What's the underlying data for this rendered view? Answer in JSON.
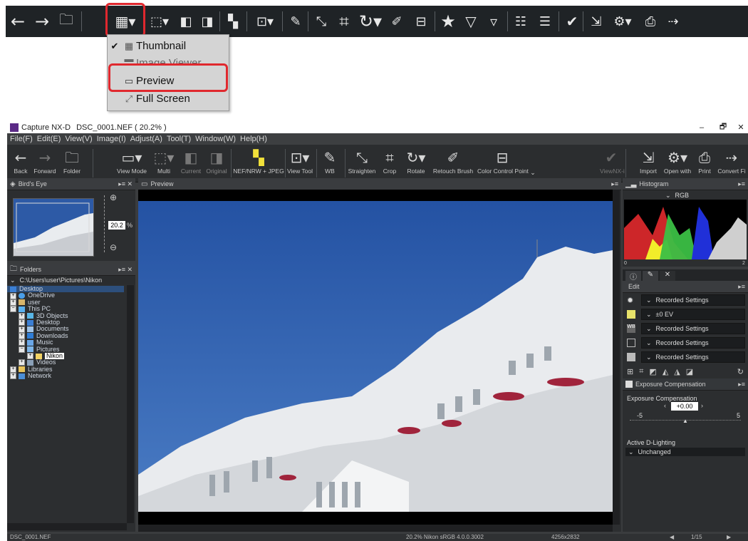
{
  "dropdown": {
    "items": [
      {
        "label": "Thumbnail",
        "checked": true,
        "icon": "grid-icon"
      },
      {
        "label": "Image Viewer",
        "checked": false,
        "icon": "filmstrip-icon"
      },
      {
        "label": "Preview",
        "checked": false,
        "icon": "preview-icon"
      },
      {
        "label": "Full Screen",
        "checked": false,
        "icon": "fullscreen-icon"
      }
    ]
  },
  "window": {
    "app_name": "Capture NX-D",
    "file_title": "DSC_0001.NEF ( 20.2% )",
    "controls": {
      "minimize": "–",
      "restore": "🗗",
      "close": "✕"
    }
  },
  "menubar": [
    "File(F)",
    "Edit(E)",
    "View(V)",
    "Image(I)",
    "Adjust(A)",
    "Tool(T)",
    "Window(W)",
    "Help(H)"
  ],
  "toolbar": {
    "back": "Back",
    "forward": "Forward",
    "folder": "Folder",
    "view_mode": "View Mode",
    "multi": "Multi",
    "current": "Current",
    "original": "Original",
    "nef_jpeg": "NEF/NRW + JPEG",
    "view_tool": "View Tool",
    "wb": "WB",
    "straighten": "Straighten",
    "crop": "Crop",
    "rotate": "Rotate",
    "retouch": "Retouch Brush",
    "color_control": "Color Control Point",
    "viewnx": "ViewNX-i",
    "import": "Import",
    "open_with": "Open with",
    "print": "Print",
    "convert": "Convert Fi"
  },
  "birds_eye": {
    "title": "Bird's Eye",
    "zoom_value": "20.2",
    "zoom_unit": "%"
  },
  "folders": {
    "title": "Folders",
    "path": "C:\\Users\\user\\Pictures\\Nikon",
    "tree": [
      {
        "label": "Desktop",
        "level": 0,
        "selected_row": true
      },
      {
        "label": "OneDrive",
        "level": 1
      },
      {
        "label": "user",
        "level": 1
      },
      {
        "label": "This PC",
        "level": 1
      },
      {
        "label": "3D Objects",
        "level": 2
      },
      {
        "label": "Desktop",
        "level": 2
      },
      {
        "label": "Documents",
        "level": 2
      },
      {
        "label": "Downloads",
        "level": 2
      },
      {
        "label": "Music",
        "level": 2
      },
      {
        "label": "Pictures",
        "level": 2
      },
      {
        "label": "Nikon",
        "level": 3,
        "highlight": true
      },
      {
        "label": "Videos",
        "level": 2
      },
      {
        "label": "Libraries",
        "level": 1
      },
      {
        "label": "Network",
        "level": 1
      }
    ]
  },
  "preview": {
    "title": "Preview"
  },
  "histogram": {
    "title": "Histogram",
    "channel": "RGB",
    "axis_min": "0",
    "axis_max": "2"
  },
  "edit": {
    "title": "Edit",
    "rows": [
      {
        "value": "Recorded Settings",
        "icon": "camera-settings-icon"
      },
      {
        "value": "±0 EV",
        "icon": "exposure-icon"
      },
      {
        "value": "Recorded Settings",
        "icon": "white-balance-icon"
      },
      {
        "value": "Recorded Settings",
        "icon": "picture-control-icon"
      },
      {
        "value": "Recorded Settings",
        "icon": "lens-icon"
      }
    ],
    "exposure_section": "Exposure Compensation",
    "exposure_label": "Exposure Compensation",
    "exposure_value": "+0.00",
    "scale_min": "-5",
    "scale_max": "5",
    "adl_label": "Active D-Lighting",
    "adl_value": "Unchanged"
  },
  "status": {
    "filename": "DSC_0001.NEF",
    "info": "20.2%  Nikon sRGB 4.0.0.3002",
    "dimensions": "4256x2832",
    "page": "1/15"
  },
  "colors": {
    "accent_red": "#e0282e",
    "panel_bg": "#2c2e30",
    "toolbar_bg": "#2b2d2f",
    "sky": "#2d5aa6"
  }
}
